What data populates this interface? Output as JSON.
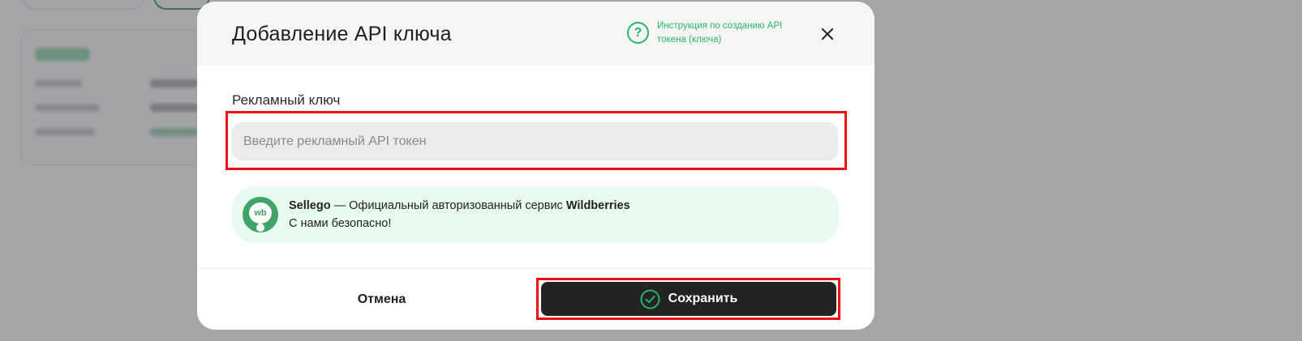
{
  "modal": {
    "title": "Добавление API ключа",
    "help_link": "Инструкция по созданию API токена (ключа)",
    "field_label": "Рекламный ключ",
    "input_placeholder": "Введите рекламный API токен",
    "input_value": "",
    "info": {
      "logo_text": "wb",
      "brand": "Sellego",
      "line1_rest": " — Официальный авторизованный сервис ",
      "platform": "Wildberries",
      "line2": "С нами безопасно!"
    },
    "cancel_label": "Отмена",
    "save_label": "Сохранить"
  },
  "icons": {
    "help": "question-circle-icon",
    "close": "close-icon",
    "save": "check-circle-icon",
    "logo": "wb-logo-icon"
  },
  "colors": {
    "accent_green": "#2ab46a",
    "info_bg": "#e8fbef",
    "primary_button": "#232323",
    "highlight": "#ee1111"
  }
}
